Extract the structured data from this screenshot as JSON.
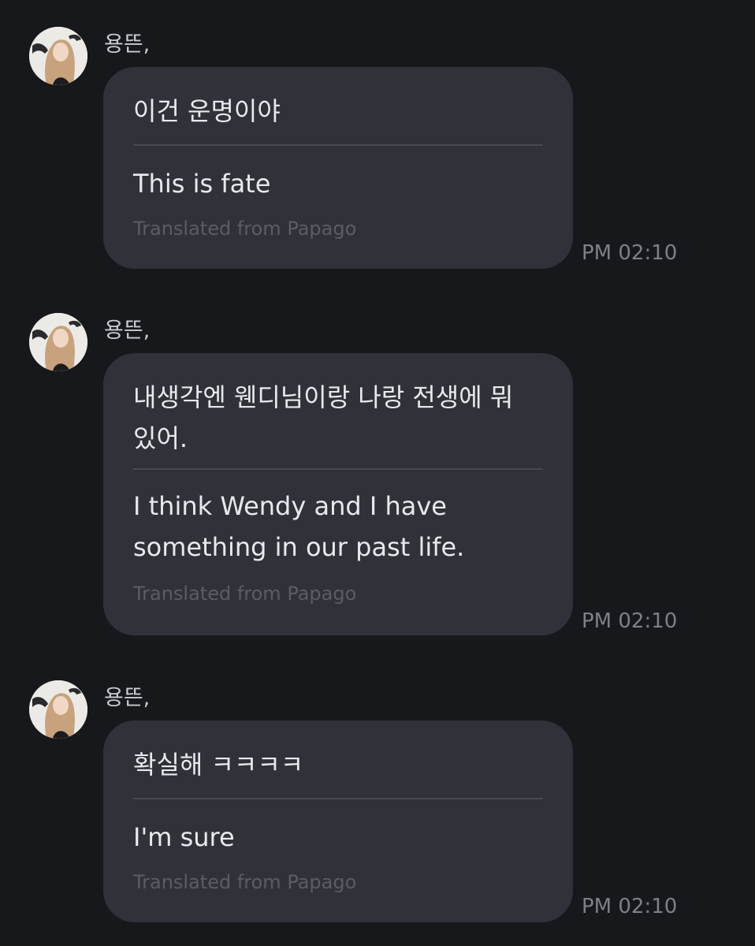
{
  "messages": [
    {
      "sender": "용뜬,",
      "original": "이건 운명이야",
      "translation": "This is fate",
      "credit": "Translated from Papago",
      "time": "PM 02:10",
      "avatar_icon": "profile-photo"
    },
    {
      "sender": "용뜬,",
      "original": "내생각엔 웬디님이랑 나랑 전생에 뭐 있어.",
      "translation": "I think Wendy and I have something in our past life.",
      "credit": "Translated from Papago",
      "time": "PM 02:10",
      "avatar_icon": "profile-photo"
    },
    {
      "sender": "용뜬,",
      "original": "확실해 ㅋㅋㅋㅋ",
      "translation": "I'm sure",
      "credit": "Translated from Papago",
      "time": "PM 02:10",
      "avatar_icon": "profile-photo"
    }
  ],
  "colors": {
    "background": "#17181b",
    "bubble": "#30323a",
    "text": "#e9e9ec",
    "muted": "#5b5d66",
    "time": "#7e8088"
  }
}
